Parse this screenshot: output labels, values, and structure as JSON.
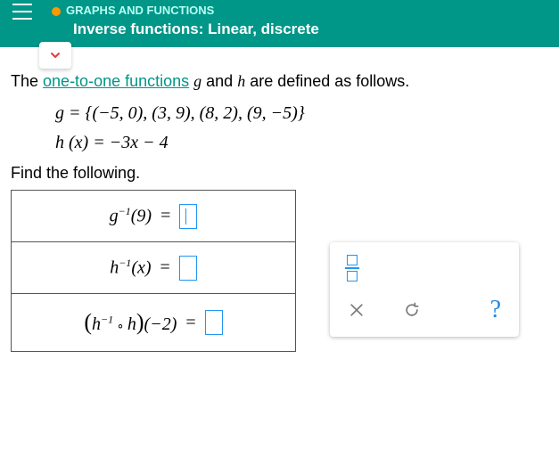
{
  "header": {
    "category": "GRAPHS AND FUNCTIONS",
    "title": "Inverse functions: Linear, discrete"
  },
  "prompt": {
    "pre": "The ",
    "link": "one-to-one functions",
    "post1": " ",
    "g": "g",
    "post2": " and ",
    "h": "h",
    "post3": " are defined as follows."
  },
  "defs": {
    "g": "g = {(−5,  0),  (3,  9),  (8,  2),  (9,  −5)}",
    "h": "h (x) = −3x − 4"
  },
  "find": "Find the following.",
  "answers": {
    "row1": {
      "lhs_base": "g",
      "lhs_sup": "−1",
      "lhs_arg": "(9)",
      "eq": "="
    },
    "row2": {
      "lhs_base": "h",
      "lhs_sup": "−1",
      "lhs_arg": "(x)",
      "eq": "="
    },
    "row3": {
      "open": "(",
      "a_base": "h",
      "a_sup": "−1",
      "circ": " ∘ ",
      "b": "h",
      "close": ")",
      "arg": "(−2)",
      "eq": "="
    }
  },
  "toolpanel": {
    "frac_tooltip": "fraction",
    "clear": "×",
    "reset": "↺",
    "help": "?"
  }
}
